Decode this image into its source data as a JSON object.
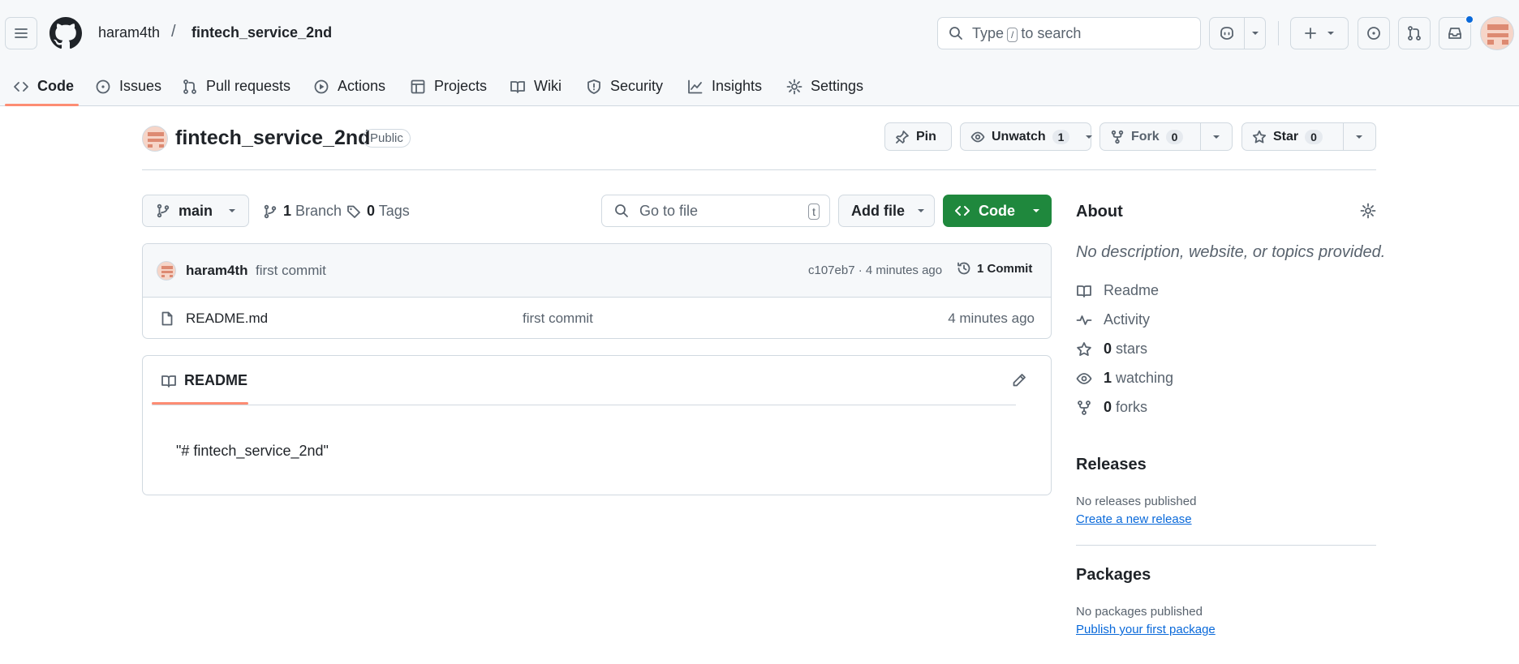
{
  "header": {
    "owner": "haram4th",
    "separator": "/",
    "repo": "fintech_service_2nd",
    "search": {
      "prefix": "Type",
      "key": "/",
      "suffix": "to search"
    },
    "notification_dot_color": "#0969da"
  },
  "tabs": [
    {
      "label": "Code",
      "icon": "code-icon",
      "active": true
    },
    {
      "label": "Issues",
      "icon": "issue-icon"
    },
    {
      "label": "Pull requests",
      "icon": "pull-request-icon"
    },
    {
      "label": "Actions",
      "icon": "play-icon"
    },
    {
      "label": "Projects",
      "icon": "table-icon"
    },
    {
      "label": "Wiki",
      "icon": "book-icon"
    },
    {
      "label": "Security",
      "icon": "shield-icon"
    },
    {
      "label": "Insights",
      "icon": "graph-icon"
    },
    {
      "label": "Settings",
      "icon": "gear-icon"
    }
  ],
  "repo": {
    "name": "fintech_service_2nd",
    "visibility": "Public",
    "pin_label": "Pin",
    "unwatch_label": "Unwatch",
    "watch_count": "1",
    "fork_label": "Fork",
    "fork_count": "0",
    "star_label": "Star",
    "star_count": "0"
  },
  "toolbar": {
    "branch": "main",
    "branches_count": "1",
    "branches_label": "Branch",
    "tags_count": "0",
    "tags_label": "Tags",
    "goto_placeholder": "Go to file",
    "goto_key": "t",
    "add_file_label": "Add file",
    "code_label": "Code"
  },
  "commit": {
    "author": "haram4th",
    "message": "first commit",
    "hash": "c107eb7",
    "time": "4 minutes ago",
    "meta_text": "c107eb7 · 4 minutes ago",
    "count_label": "1 Commit"
  },
  "files": [
    {
      "name": "README.md",
      "message": "first commit",
      "time": "4 minutes ago"
    }
  ],
  "readme": {
    "tab_label": "README",
    "content": "\"# fintech_service_2nd\""
  },
  "about": {
    "title": "About",
    "description": "No description, website, or topics provided.",
    "items": [
      {
        "icon": "book-icon",
        "count": "",
        "label": "Readme"
      },
      {
        "icon": "pulse-icon",
        "count": "",
        "label": "Activity"
      },
      {
        "icon": "star-icon",
        "count": "0",
        "label": "stars"
      },
      {
        "icon": "eye-icon",
        "count": "1",
        "label": "watching"
      },
      {
        "icon": "fork-icon",
        "count": "0",
        "label": "forks"
      }
    ]
  },
  "releases": {
    "title": "Releases",
    "empty_text": "No releases published",
    "link": "Create a new release"
  },
  "packages": {
    "title": "Packages",
    "empty_text": "No packages published",
    "link": "Publish your first package"
  },
  "colors": {
    "accent_green": "#1f883d",
    "link_blue": "#0969da",
    "tab_underline": "#fd8c73"
  }
}
